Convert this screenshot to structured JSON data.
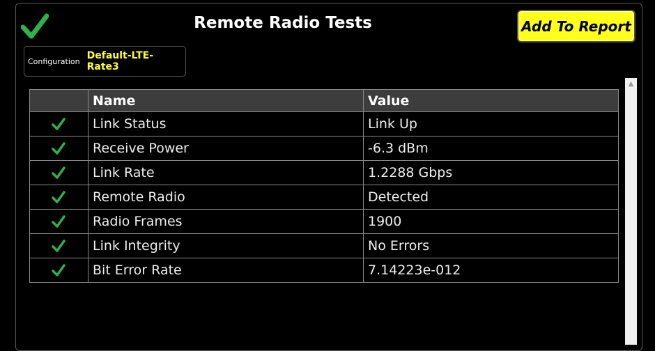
{
  "header": {
    "title": "Remote Radio Tests",
    "add_button_label": "Add To Report"
  },
  "config": {
    "label": "Configuration",
    "value": "Default-LTE-Rate3"
  },
  "table": {
    "columns": [
      "",
      "Name",
      "Value"
    ],
    "rows": [
      {
        "name": "Link Status",
        "value": "Link Up"
      },
      {
        "name": "Receive Power",
        "value": "-6.3 dBm"
      },
      {
        "name": "Link Rate",
        "value": "1.2288 Gbps"
      },
      {
        "name": "Remote Radio",
        "value": "Detected"
      },
      {
        "name": "Radio Frames",
        "value": "1900"
      },
      {
        "name": "Link Integrity",
        "value": "No Errors"
      },
      {
        "name": "Bit Error Rate",
        "value": "7.14223e-012"
      }
    ]
  },
  "scrollbar": {
    "up_glyph": "▲"
  },
  "colors": {
    "check_green": "#2db34a",
    "button_yellow": "#ffff1a",
    "config_value": "#ffff33",
    "header_bg": "#3d3d3d"
  }
}
